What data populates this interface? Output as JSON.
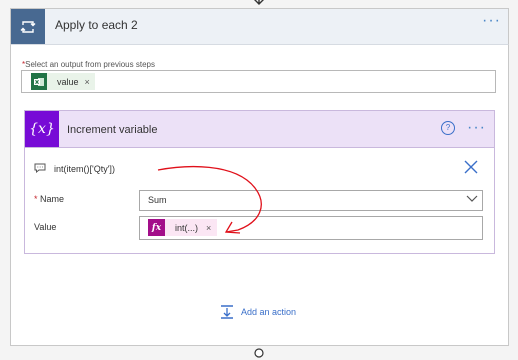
{
  "apply_to_each": {
    "title": "Apply to each 2",
    "more": "···",
    "select_label_required": "*",
    "select_label": "Select an output from previous steps",
    "token": {
      "icon": "excel-icon",
      "label": "value",
      "remove": "×"
    }
  },
  "increment_variable": {
    "title": "Increment variable",
    "icon_glyph": "{x}",
    "help": "?",
    "more": "···",
    "comment": "int(item()['Qty'])",
    "name_required": "*",
    "name_label": "Name",
    "name_value": "Sum",
    "value_label": "Value",
    "value_token": {
      "icon_glyph": "fx",
      "label": "int(...)",
      "remove": "×"
    }
  },
  "add_action": {
    "label": "Add an action"
  },
  "colors": {
    "loop_header": "#486991",
    "variable_header": "#770bd6",
    "expression_token": "#a30e8a",
    "excel": "#217346",
    "link": "#3a6fc9",
    "annotation": "#e0101a"
  }
}
